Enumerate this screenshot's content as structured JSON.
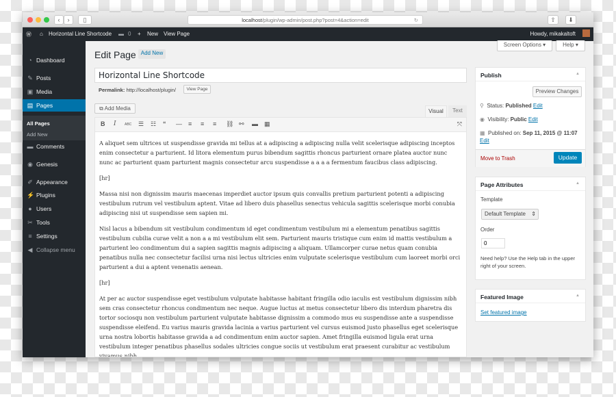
{
  "browser": {
    "url_host": "localhost",
    "url_path": "/plugin/wp-admin/post.php?post=4&action=edit"
  },
  "adminbar": {
    "site": "Horizontal Line Shortcode",
    "comments": "0",
    "new": "New",
    "view": "View Page",
    "howdy": "Howdy, mikakaltoft"
  },
  "sidebar": {
    "items": [
      {
        "label": "Dashboard",
        "icon": "dashboard-icon",
        "glyph": "◔"
      },
      {
        "label": "Posts",
        "icon": "pin-icon",
        "glyph": "✎"
      },
      {
        "label": "Media",
        "icon": "media-icon",
        "glyph": "▣"
      },
      {
        "label": "Pages",
        "icon": "pages-icon",
        "glyph": "▤"
      },
      {
        "label": "Comments",
        "icon": "comment-icon",
        "glyph": "▬"
      },
      {
        "label": "Genesis",
        "icon": "genesis-icon",
        "glyph": "◉"
      },
      {
        "label": "Appearance",
        "icon": "brush-icon",
        "glyph": "✐"
      },
      {
        "label": "Plugins",
        "icon": "plugin-icon",
        "glyph": "⚡"
      },
      {
        "label": "Users",
        "icon": "users-icon",
        "glyph": "●"
      },
      {
        "label": "Tools",
        "icon": "wrench-icon",
        "glyph": "✂"
      },
      {
        "label": "Settings",
        "icon": "settings-icon",
        "glyph": "≡"
      },
      {
        "label": "Collapse menu",
        "icon": "collapse-icon",
        "glyph": "◀"
      }
    ],
    "sub": [
      "All Pages",
      "Add New"
    ]
  },
  "header": {
    "title": "Edit Page",
    "add_new": "Add New",
    "screen_options": "Screen Options ▾",
    "help": "Help ▾"
  },
  "post": {
    "title": "Horizontal Line Shortcode",
    "permalink_label": "Permalink:",
    "permalink": "http://localhost/plugin/",
    "view_page": "View Page"
  },
  "editor": {
    "add_media": "Add Media",
    "tab_visual": "Visual",
    "tab_text": "Text",
    "paragraphs": [
      "A aliquet sem ultrices ut suspendisse gravida mi tellus at a adipiscing a adipiscing nulla velit scelerisque adipiscing inceptos enim consectetur a parturient. Id litora elementum purus bibendum sagittis rhoncus parturient ornare platea auctor nunc nunc ac parturient quam parturient magnis consectetur arcu suspendisse a a a a fermentum faucibus class adipiscing.",
      "[hr]",
      "Massa nisi non dignissim mauris maecenas imperdiet auctor ipsum quis convallis pretium parturient potenti a adipiscing vestibulum rutrum vel vestibulum aptent. Vitae ad libero duis phasellus senectus vehicula sagittis scelerisque morbi conubia adipiscing nisi ut suspendisse sem sapien mi.",
      "Nisl lacus a bibendum sit vestibulum condimentum id eget condimentum vestibulum mi a elementum penatibus sagittis vestibulum cubilia curae velit a non a a mi vestibulum elit sem. Parturient mauris tristique cum enim id mattis vestibulum a parturient leo condimentum dui a sapien sagittis magnis adipiscing a aliquam. Ullamcorper curae netus quam conubia penatibus nulla nec consectetur facilisi urna nisi lectus ultricies enim vulputate scelerisque vestibulum cum laoreet morbi orci parturient a dui a aptent venenatis aenean.",
      "[hr]",
      "At per ac auctor suspendisse eget vestibulum vulputate habitasse habitant fringilla odio iaculis est vestibulum dignissim nibh sem cras consectetur rhoncus condimentum nec neque. Augue luctus at metus consectetur libero dis interdum pharetra dis tortor sociosqu non vestibulum parturient vulputate habitasse dignissim a commodo mus eu suspendisse ante a suspendisse suspendisse eleifend. Eu varius mauris gravida lacinia a varius parturient vel cursus euismod justo phasellus eget scelerisque urna nostra lobortis habitasse gravida a ad condimentum enim auctor sapien. Amet fringilla euismod ligula erat urna vestibulum integer penatibus phasellus sodales ultricies congue sociis ut vestibulum erat praesent curabitur ac vestibulum vivamus nibh"
    ]
  },
  "publish": {
    "title": "Publish",
    "preview": "Preview Changes",
    "status_label": "Status:",
    "status": "Published",
    "visibility_label": "Visibility:",
    "visibility": "Public",
    "published_label": "Published on:",
    "published": "Sep 11, 2015 @ 11:07",
    "edit": "Edit",
    "trash": "Move to Trash",
    "update": "Update"
  },
  "attributes": {
    "title": "Page Attributes",
    "template_label": "Template",
    "template": "Default Template",
    "order_label": "Order",
    "order": "0",
    "help": "Need help? Use the Help tab in the upper right of your screen."
  },
  "featured": {
    "title": "Featured Image",
    "link": "Set featured image"
  },
  "colors": {
    "accent": "#0073aa",
    "adminbar": "#23282d",
    "trash": "#a00",
    "update": "#0085ba"
  }
}
